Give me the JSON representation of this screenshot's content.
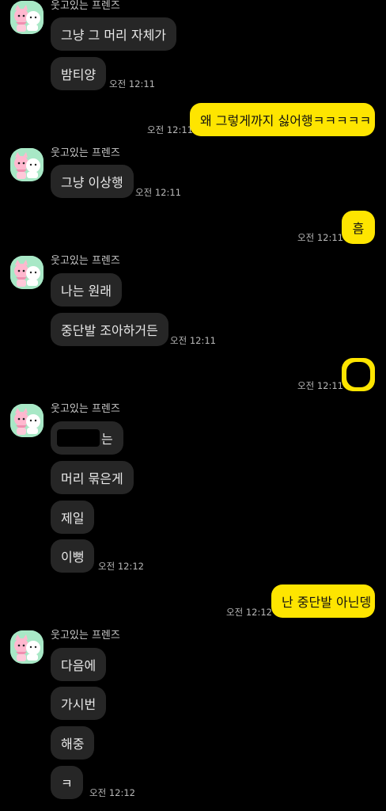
{
  "sender_name": "웃고있는 프렌즈",
  "bubbles": [
    "그냥 그 머리 자체가",
    "밤티양",
    "왜 그렇게까지 싫어행ㅋㅋㅋㅋㅋ",
    "그냥 이상행",
    "흠",
    "나는 원래",
    "중단발 조아하거든",
    "는",
    "머리 묶은게",
    "제일",
    "이뻥",
    "난 중단발 아닌뎅",
    "다음에",
    "가시번",
    "해중",
    "ㅋ"
  ],
  "times": [
    "오전 12:11",
    "오전 12:11",
    "오전 12:11",
    "오전 12:11",
    "오전 12:11",
    "오전 12:11",
    "오전 12:12",
    "오전 12:12",
    "오전 12:12"
  ],
  "colors": {
    "background": "#000000",
    "incoming_bubble": "#262626",
    "outgoing_bubble": "#fee500",
    "avatar_bg": "#9fe6c0"
  },
  "icons": {
    "avatar": "friends-character-avatar-icon",
    "redaction": "redacted-content"
  }
}
